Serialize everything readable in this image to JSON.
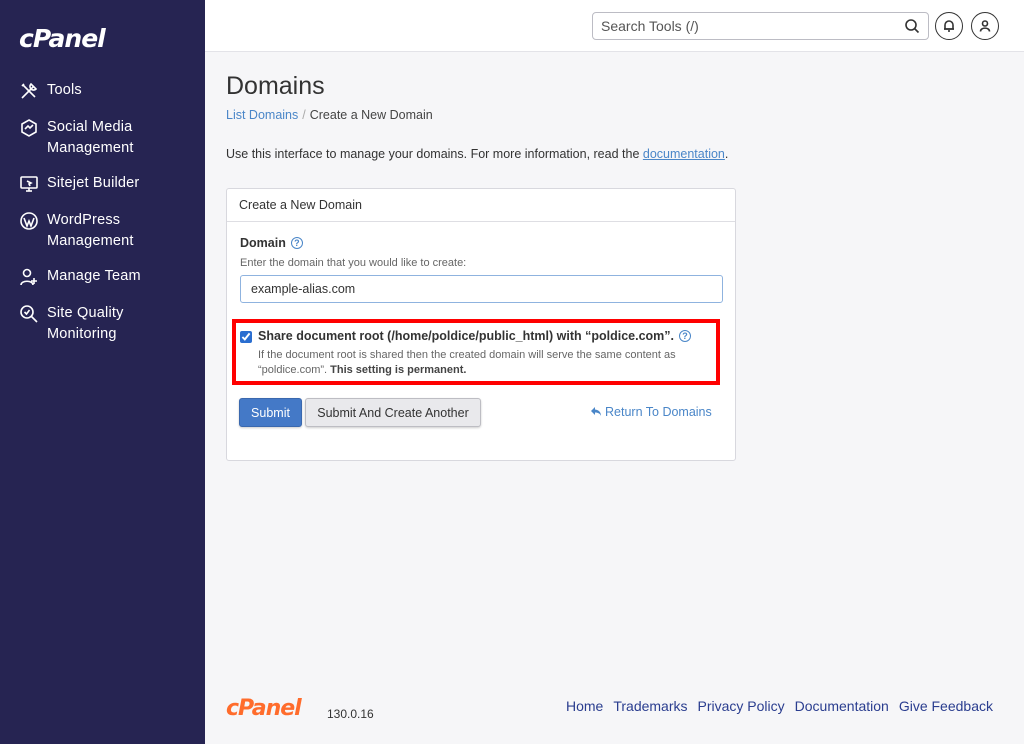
{
  "brand": {
    "logo_text": "cPanel",
    "version": "130.0.16"
  },
  "sidebar": {
    "items": [
      {
        "label": "Tools",
        "icon": "tools-icon"
      },
      {
        "label": "Social Media Management",
        "icon": "social-media-icon"
      },
      {
        "label": "Sitejet Builder",
        "icon": "sitejet-icon"
      },
      {
        "label": "WordPress Management",
        "icon": "wordpress-icon"
      },
      {
        "label": "Manage Team",
        "icon": "team-icon"
      },
      {
        "label": "Site Quality Monitoring",
        "icon": "magnifier-icon"
      }
    ]
  },
  "header": {
    "search_placeholder": "Search Tools (/)"
  },
  "main": {
    "title": "Domains",
    "breadcrumb": {
      "parent": "List Domains",
      "separator": "/",
      "current": "Create a New Domain"
    },
    "intro_text": "Use this interface to manage your domains. For more information, read the ",
    "intro_link": "documentation",
    "intro_end": ".",
    "panel": {
      "heading": "Create a New Domain",
      "domain_label": "Domain",
      "domain_help": "Enter the domain that you would like to create:",
      "domain_value": "example-alias.com",
      "share_checked": true,
      "share_label": "Share document root (/home/poldice/public_html) with “poldice.com”.",
      "share_desc": "If the document root is shared then the created domain will serve the same content as “poldice.com”.",
      "share_desc_bold": "This setting is permanent.",
      "submit_label": "Submit",
      "submit_another_label": "Submit And Create Another",
      "return_label": "Return To Domains"
    }
  },
  "footer": {
    "links": [
      "Home",
      "Trademarks",
      "Privacy Policy",
      "Documentation",
      "Give Feedback"
    ]
  },
  "colors": {
    "sidebar_bg": "#262452",
    "accent": "#4479c7",
    "link": "#4a86c8",
    "highlight": "#ff0000",
    "footer_logo": "#ff6c2c"
  }
}
